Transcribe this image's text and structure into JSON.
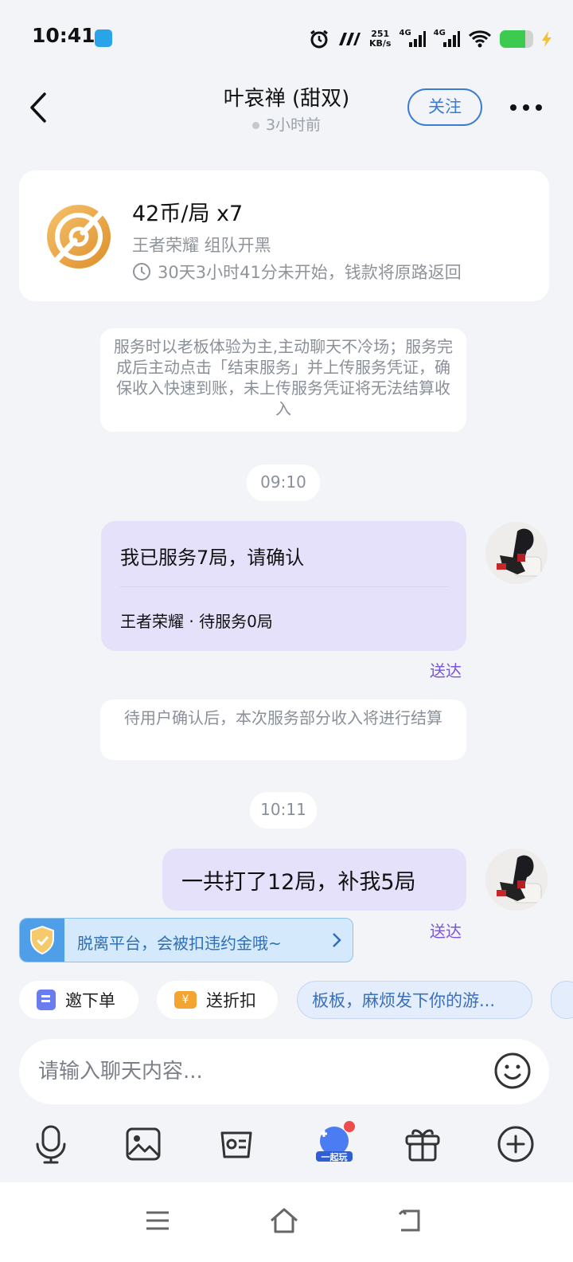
{
  "status_bar": {
    "time": "10:41",
    "speed_value": "251",
    "speed_unit": "KB/s",
    "net1": "4G",
    "net2": "4G"
  },
  "header": {
    "title": "叶哀禅 (甜双)",
    "subtitle": "3小时前",
    "follow_label": "关注"
  },
  "order": {
    "price": "42币/局 x7",
    "game": "王者荣耀 组队开黑",
    "timer": "30天3小时41分未开始，钱款将原路返回"
  },
  "notices": {
    "service_tip": "服务时以老板体验为主,主动聊天不冷场；服务完成后主动点击「结束服务」并上传服务凭证，确保收入快速到账，未上传服务凭证将无法结算收入",
    "settle_tip": "待用户确认后，本次服务部分收入将进行结算"
  },
  "messages": [
    {
      "time": "09:10",
      "text": "我已服务7局，请确认",
      "sub": "王者荣耀 · 待服务0局",
      "status": "送达"
    },
    {
      "time": "10:11",
      "text": "一共打了12局，补我5局",
      "status": "送达"
    }
  ],
  "warning": {
    "text": "脱离平台，会被扣违约金哦~"
  },
  "quick_actions": {
    "invite_order": "邀下单",
    "send_discount": "送折扣",
    "ask_game": "板板，麻烦发下你的游...",
    "coupon_glyph": "¥"
  },
  "input": {
    "placeholder": "请输入聊天内容..."
  },
  "toolbar": {
    "play_together": "一起玩"
  },
  "colors": {
    "accent": "#3a7bd5",
    "bubble": "#e6e1fb",
    "delivered": "#7b55d9",
    "background": "#f2f4f8"
  }
}
